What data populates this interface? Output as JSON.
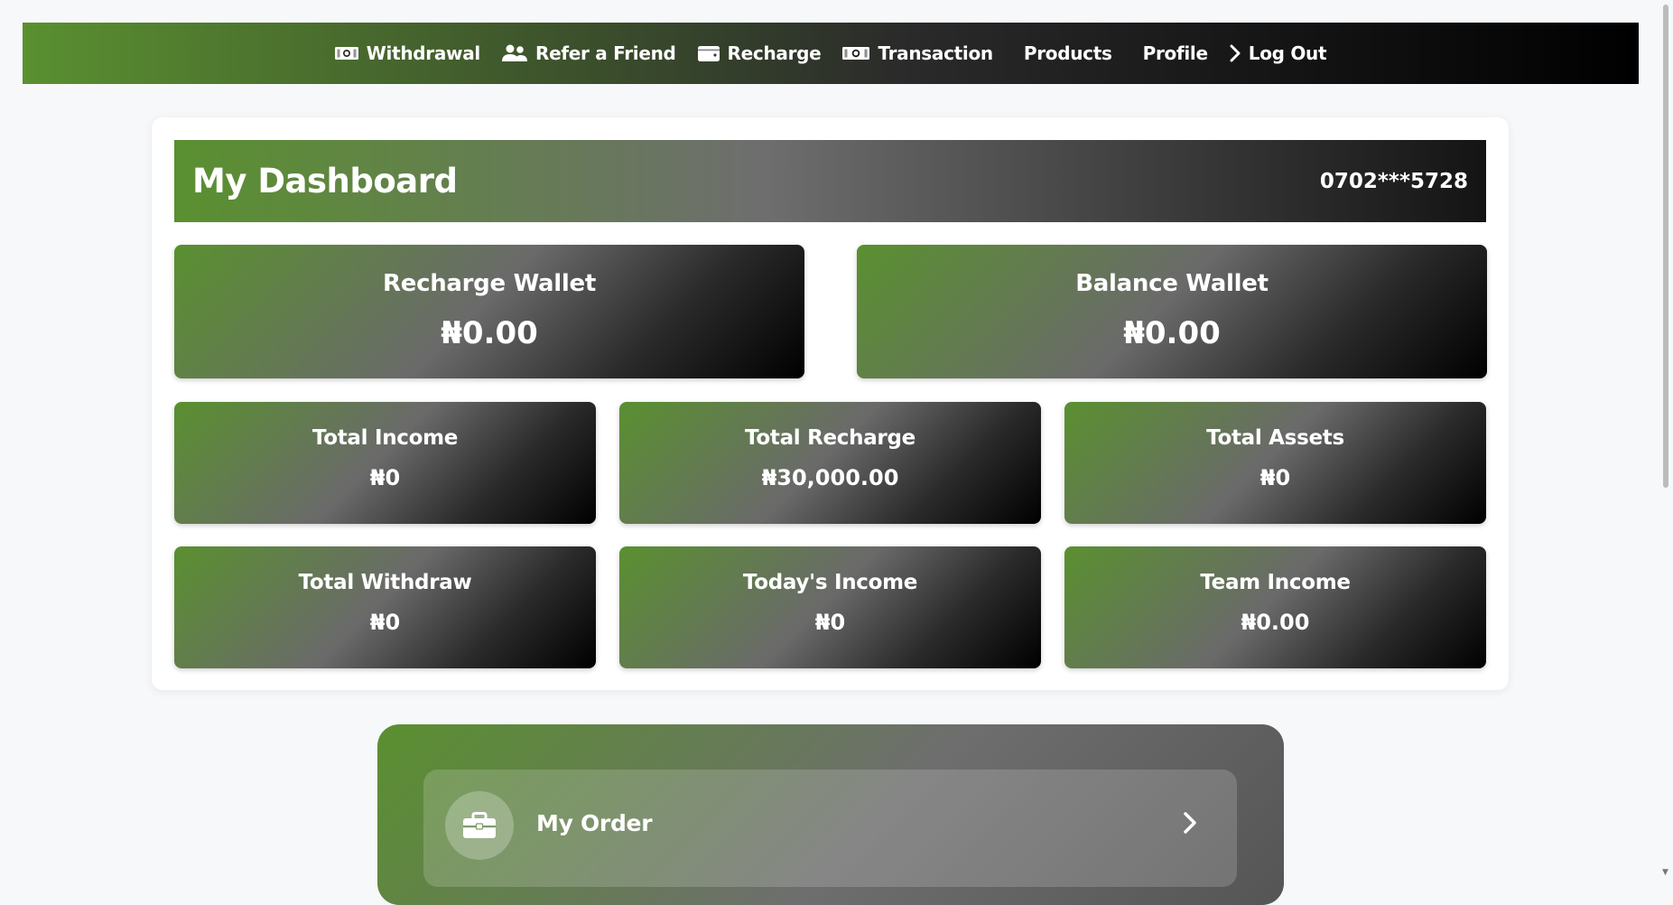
{
  "nav": {
    "items": [
      {
        "label": "Withdrawal",
        "icon": "money-bill-icon"
      },
      {
        "label": "Refer a Friend",
        "icon": "users-icon"
      },
      {
        "label": "Recharge",
        "icon": "wallet-icon"
      },
      {
        "label": "Transaction",
        "icon": "money-bill-icon"
      },
      {
        "label": "Products",
        "icon": ""
      },
      {
        "label": "Profile",
        "icon": ""
      },
      {
        "label": "Log Out",
        "icon": "chevron-right-icon"
      }
    ]
  },
  "dashboard": {
    "title": "My Dashboard",
    "phone": "0702***5728"
  },
  "wallets": [
    {
      "label": "Recharge Wallet",
      "value": "₦0.00"
    },
    {
      "label": "Balance Wallet",
      "value": "₦0.00"
    }
  ],
  "stats": [
    {
      "label": "Total Income",
      "value": "₦0"
    },
    {
      "label": "Total Recharge",
      "value": "₦30,000.00"
    },
    {
      "label": "Total Assets",
      "value": "₦0"
    },
    {
      "label": "Total Withdraw",
      "value": "₦0"
    },
    {
      "label": "Today's Income",
      "value": "₦0"
    },
    {
      "label": "Team Income",
      "value": "₦0.00"
    }
  ],
  "order": {
    "label": "My Order",
    "icon": "briefcase-icon"
  },
  "colors": {
    "brand_green": "#5a9030",
    "dark": "#000000",
    "page_bg": "#f7f8fa"
  }
}
